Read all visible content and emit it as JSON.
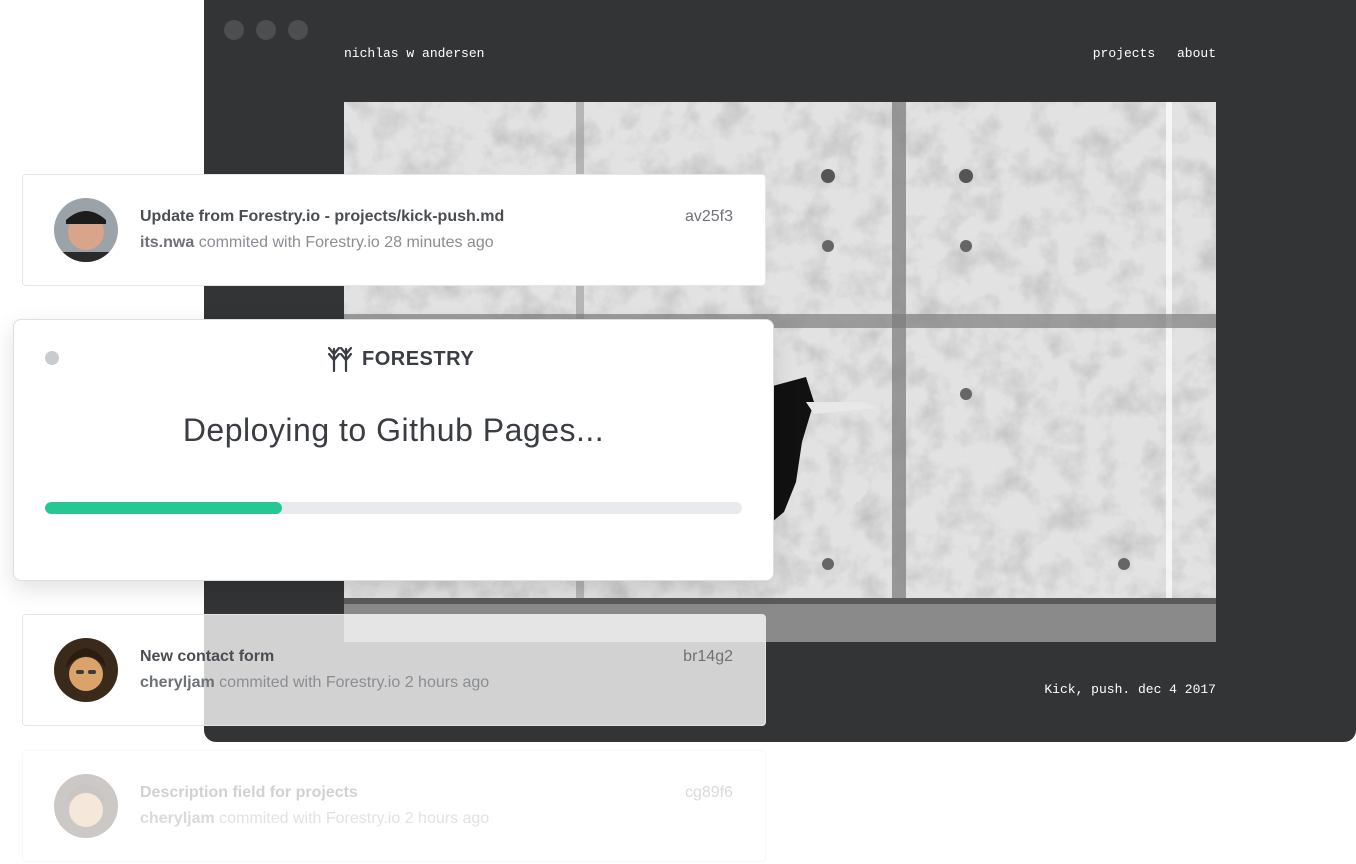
{
  "site": {
    "brand": "nichlas w andersen",
    "nav": [
      "projects",
      "about"
    ],
    "caption": "Kick, push. dec 4 2017"
  },
  "commits": [
    {
      "title": "Update from Forestry.io - projects/kick-push.md",
      "author": "its.nwa",
      "meta": "commited with Forestry.io 28 minutes ago",
      "hash": "av25f3"
    },
    {
      "title": "New contact form",
      "author": "cheryljam",
      "meta": "commited with Forestry.io 2 hours ago",
      "hash": "br14g2"
    },
    {
      "title": "Description field for projects",
      "author": "cheryljam",
      "meta": "commited with Forestry.io 2 hours ago",
      "hash": "cg89f6"
    }
  ],
  "modal": {
    "logo_text": "FORESTRY",
    "logo_icon": "forestry-trees-icon",
    "title": "Deploying to Github Pages...",
    "progress_percent": 34
  },
  "colors": {
    "window_bg": "#333435",
    "progress": "#27c794",
    "track": "#e8ebee"
  }
}
